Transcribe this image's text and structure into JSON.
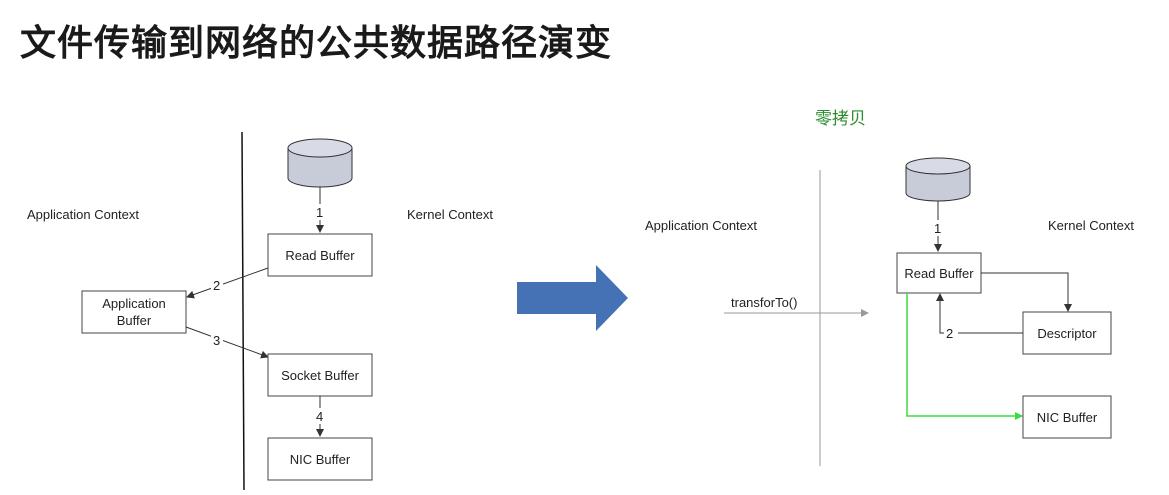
{
  "title": "文件传输到网络的公共数据路径演变",
  "subtitle": "零拷贝",
  "left": {
    "app_context": "Application Context",
    "kernel_context": "Kernel Context",
    "read_buffer": "Read Buffer",
    "app_buffer_line1": "Application",
    "app_buffer_line2": "Buffer",
    "socket_buffer": "Socket Buffer",
    "nic_buffer": "NIC Buffer",
    "step1": "1",
    "step2": "2",
    "step3": "3",
    "step4": "4"
  },
  "right": {
    "app_context": "Application Context",
    "kernel_context": "Kernel Context",
    "read_buffer": "Read Buffer",
    "descriptor": "Descriptor",
    "nic_buffer": "NIC Buffer",
    "call": "transforTo()",
    "step1": "1",
    "step2": "2"
  },
  "colors": {
    "arrow_fill": "#4472b4",
    "green_path": "#3ddc3d",
    "subtitle": "#2e8b2e"
  }
}
